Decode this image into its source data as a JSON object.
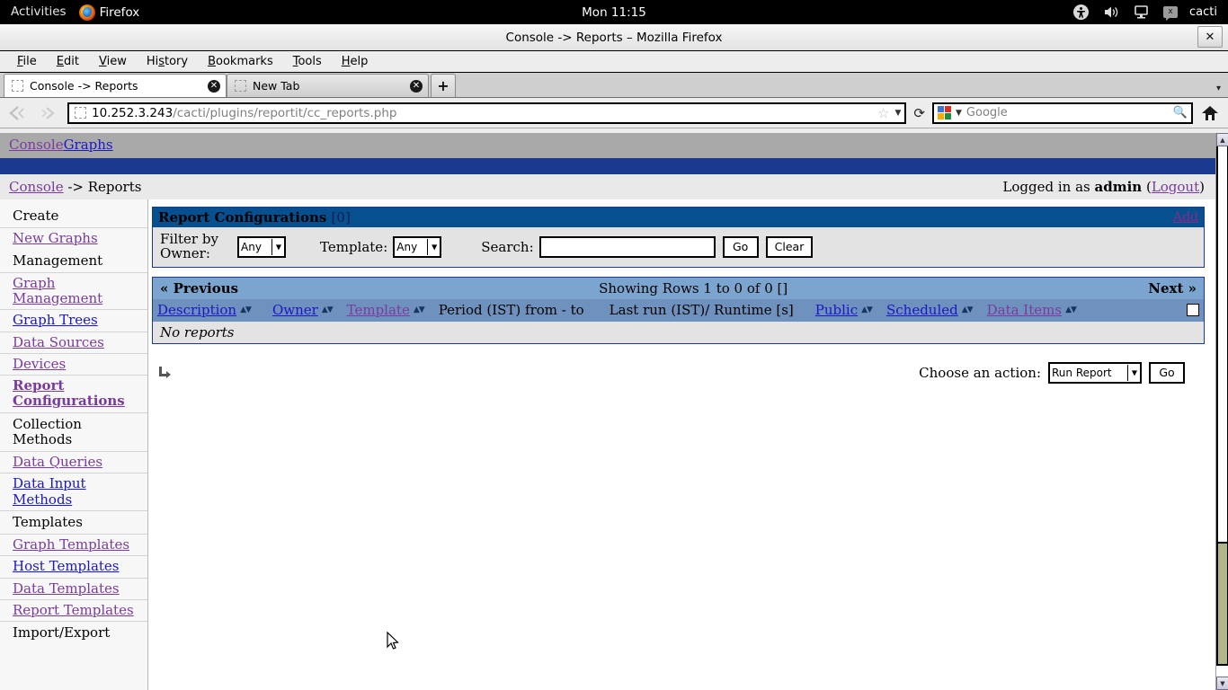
{
  "gnome": {
    "activities": "Activities",
    "app_name": "Firefox",
    "clock": "Mon 11:15",
    "username": "cacti",
    "icons": [
      "accessibility-icon",
      "volume-icon",
      "display-icon",
      "terminal-icon"
    ]
  },
  "window": {
    "title": "Console -> Reports – Mozilla Firefox",
    "close_label": "✕"
  },
  "menubar": [
    {
      "label": "File",
      "accel": "F"
    },
    {
      "label": "Edit",
      "accel": "E"
    },
    {
      "label": "View",
      "accel": "V"
    },
    {
      "label": "History",
      "accel": "s"
    },
    {
      "label": "Bookmarks",
      "accel": "B"
    },
    {
      "label": "Tools",
      "accel": "T"
    },
    {
      "label": "Help",
      "accel": "H"
    }
  ],
  "tabs": [
    {
      "label": "Console -> Reports",
      "active": true
    },
    {
      "label": "New Tab",
      "active": false
    }
  ],
  "tab_new_label": "+",
  "urlbar": {
    "host": "10.252.3.243",
    "path": "/cacti/plugins/reportit/cc_reports.php"
  },
  "searchbar": {
    "engine": "Google",
    "placeholder": "Google"
  },
  "cacti": {
    "topbar": [
      {
        "label": "Console",
        "state": "visited"
      },
      {
        "label": "Graphs",
        "state": "normal"
      }
    ],
    "breadcrumb_link": "Console",
    "breadcrumb_rest": " -> Reports",
    "logged_in_prefix": "Logged in as ",
    "logged_in_user": "admin",
    "logout_open": " (",
    "logout_label": "Logout",
    "logout_close": ")"
  },
  "sidebar": {
    "items": [
      {
        "label": "Create",
        "type": "header"
      },
      {
        "label": "New Graphs",
        "type": "link",
        "state": "visited"
      },
      {
        "label": "Management",
        "type": "header"
      },
      {
        "label": "Graph Management",
        "type": "link",
        "state": "visited"
      },
      {
        "label": "Graph Trees",
        "type": "link",
        "state": "normal"
      },
      {
        "label": "Data Sources",
        "type": "link",
        "state": "visited"
      },
      {
        "label": "Devices",
        "type": "link",
        "state": "visited"
      },
      {
        "label": "Report Configurations",
        "type": "link",
        "state": "visited",
        "current": true
      },
      {
        "label": "Collection Methods",
        "type": "header"
      },
      {
        "label": "Data Queries",
        "type": "link",
        "state": "visited"
      },
      {
        "label": "Data Input Methods",
        "type": "link",
        "state": "normal"
      },
      {
        "label": "Templates",
        "type": "header"
      },
      {
        "label": "Graph Templates",
        "type": "link",
        "state": "visited"
      },
      {
        "label": "Host Templates",
        "type": "link",
        "state": "normal"
      },
      {
        "label": "Data Templates",
        "type": "link",
        "state": "visited"
      },
      {
        "label": "Report Templates",
        "type": "link",
        "state": "visited"
      },
      {
        "label": "Import/Export",
        "type": "header"
      }
    ]
  },
  "panel": {
    "title": "Report Configurations",
    "count": "[0]",
    "add_label": "Add",
    "filter_owner_label": "Filter by Owner:",
    "owner_value": "Any",
    "template_label": "Template:",
    "template_value": "Any",
    "search_label": "Search:",
    "search_value": "",
    "go_label": "Go",
    "clear_label": "Clear"
  },
  "table": {
    "prev_label": "« Previous",
    "showing": "Showing Rows 1 to 0 of 0 []",
    "next_label": "Next »",
    "sort_arrows": "▲▼",
    "columns": [
      {
        "label": "Description",
        "sortable": true,
        "state": "normal"
      },
      {
        "label": "Owner",
        "sortable": true,
        "state": "normal"
      },
      {
        "label": "Template",
        "sortable": true,
        "state": "visited"
      },
      {
        "label": "Period (IST) from - to",
        "sortable": false
      },
      {
        "label": "Last run (IST)/ Runtime [s]",
        "sortable": false
      },
      {
        "label": "Public",
        "sortable": true,
        "state": "normal"
      },
      {
        "label": "Scheduled",
        "sortable": true,
        "state": "normal"
      },
      {
        "label": "Data Items",
        "sortable": true,
        "state": "visited"
      }
    ],
    "empty_message": "No reports"
  },
  "action": {
    "label": "Choose an action:",
    "selected": "Run Report",
    "go_label": "Go"
  },
  "colors": {
    "panel_header_bg": "#06508f",
    "nav_row_bg": "#7ba5cf",
    "header_row_bg": "#6f91bd",
    "top_blue_bar": "#1a3a8f",
    "visited_link": "#7a3a9e",
    "normal_link": "#1a17c4",
    "add_link": "#8a2a8a",
    "scrollbar_thumb": "#b5b58a"
  }
}
